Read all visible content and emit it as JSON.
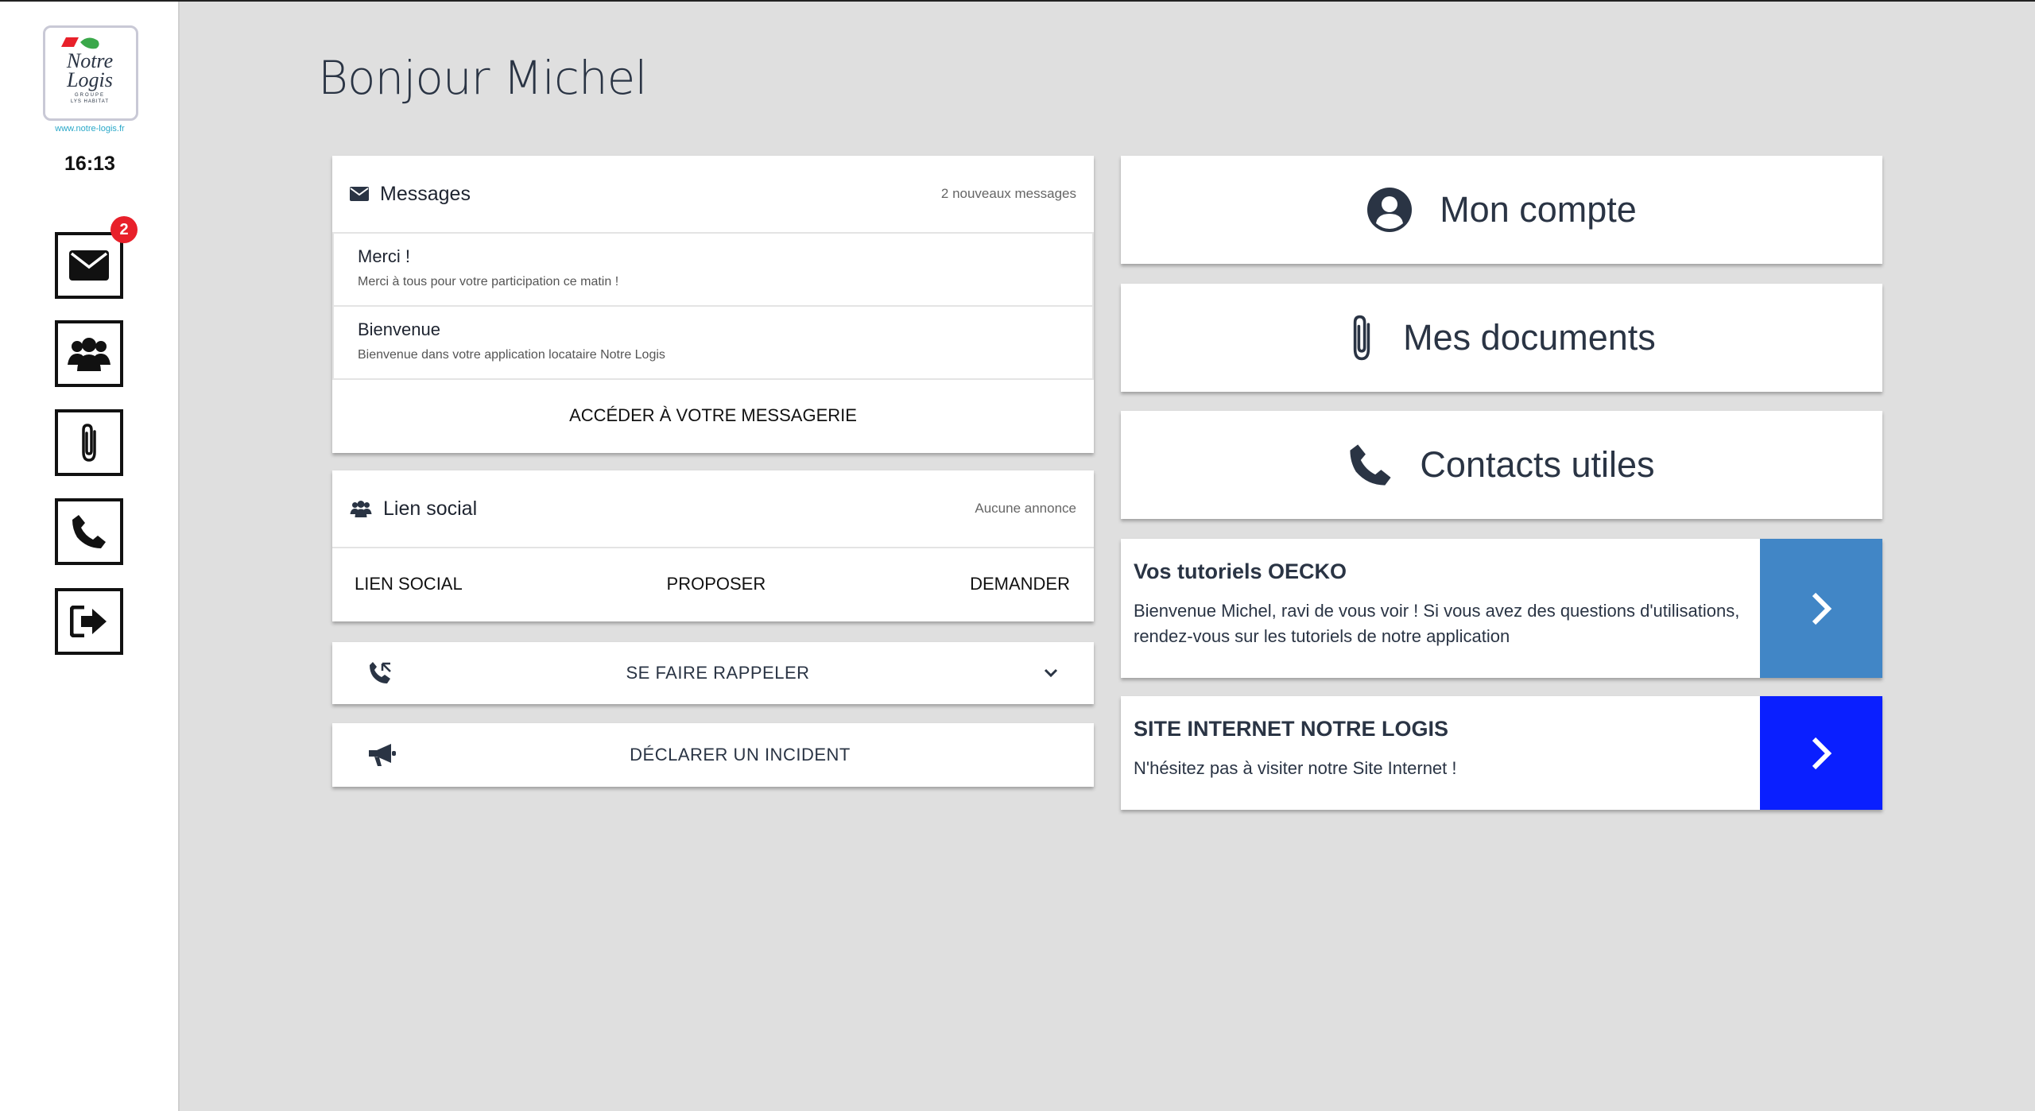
{
  "sidebar": {
    "logo": {
      "line1": "Notre",
      "line2": "Logis",
      "group": "GROUPE",
      "sub": "LYS HABITAT"
    },
    "website": "www.notre-logis.fr",
    "time": "16:13",
    "nav": [
      {
        "name": "messages",
        "icon": "envelope-icon",
        "badge": "2"
      },
      {
        "name": "social",
        "icon": "users-icon"
      },
      {
        "name": "documents",
        "icon": "paperclip-icon"
      },
      {
        "name": "contacts",
        "icon": "phone-icon"
      },
      {
        "name": "logout",
        "icon": "sign-out-icon"
      }
    ]
  },
  "greeting": "Bonjour Michel",
  "messages": {
    "title": "Messages",
    "count_label": "2 nouveaux messages",
    "items": [
      {
        "subject": "Merci !",
        "preview": "Merci à tous pour votre participation ce matin !"
      },
      {
        "subject": "Bienvenue",
        "preview": "Bienvenue dans votre application locataire Notre Logis"
      }
    ],
    "link_label": "ACCÉDER À VOTRE MESSAGERIE"
  },
  "social": {
    "title": "Lien social",
    "meta": "Aucune annonce",
    "actions": [
      "LIEN SOCIAL",
      "PROPOSER",
      "DEMANDER"
    ]
  },
  "rappel": {
    "label": "SE FAIRE RAPPELER"
  },
  "incident": {
    "label": "DÉCLARER UN INCIDENT"
  },
  "tiles": {
    "compte": "Mon compte",
    "documents": "Mes documents",
    "contacts": "Contacts utiles"
  },
  "tutoriels": {
    "title": "Vos tutoriels OECKO",
    "description": "Bienvenue Michel, ravi de vous voir ! Si vous avez des questions d'utilisations, rendez-vous sur les tutoriels de notre application"
  },
  "site": {
    "title": "SITE INTERNET NOTRE LOGIS",
    "description": "N'hésitez pas à visiter notre Site Internet !"
  },
  "colors": {
    "badge": "#e8202a",
    "tuto_arrow_bg": "#4186c6",
    "site_arrow_bg": "#0a1fff",
    "text_dark": "#2a3444"
  }
}
